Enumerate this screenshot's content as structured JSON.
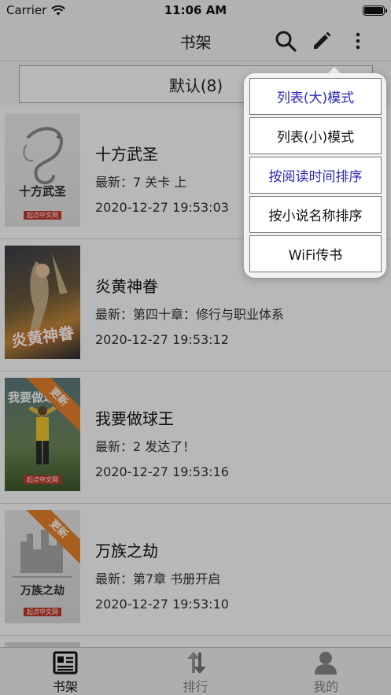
{
  "status_bar": {
    "carrier": "Carrier",
    "time": "11:06 AM"
  },
  "nav": {
    "title": "书架",
    "search_icon": "search-icon",
    "edit_icon": "pencil-icon",
    "more_icon": "more-vertical-icon"
  },
  "group_bar": {
    "label": "默认(8)"
  },
  "books": [
    {
      "title": "十方武圣",
      "latest": "最新：7 关卡 上",
      "time": "2020-12-27 19:53:03",
      "cover_text": "十方武圣",
      "cover_publisher": "起点中文网",
      "updated_badge": ""
    },
    {
      "title": "炎黄神眷",
      "latest": "最新：第四十章：修行与职业体系",
      "time": "2020-12-27 19:53:12",
      "cover_text": "炎黄神眷",
      "cover_publisher": "",
      "updated_badge": ""
    },
    {
      "title": "我要做球王",
      "latest": "最新：2 发达了！",
      "time": "2020-12-27 19:53:16",
      "cover_text": "我要做球",
      "cover_publisher": "起点中文网",
      "updated_badge": "更新"
    },
    {
      "title": "万族之劫",
      "latest": "最新：第7章 书册开启",
      "time": "2020-12-27 19:53:10",
      "cover_text": "万族之劫",
      "cover_publisher": "起点中文网",
      "updated_badge": "更新"
    }
  ],
  "popup_menu": {
    "items": [
      {
        "label": "列表(大)模式",
        "active": true
      },
      {
        "label": "列表(小)模式",
        "active": false
      },
      {
        "label": "按阅读时间排序",
        "active": true
      },
      {
        "label": "按小说名称排序",
        "active": false
      },
      {
        "label": "WiFi传书",
        "active": false
      }
    ]
  },
  "tab_bar": {
    "tabs": [
      {
        "label": "书架",
        "icon": "bookshelf-icon",
        "selected": true
      },
      {
        "label": "排行",
        "icon": "ranking-arrows-icon",
        "selected": false
      },
      {
        "label": "我的",
        "icon": "profile-icon",
        "selected": false
      }
    ]
  },
  "colors": {
    "accent": "#2a2ab8",
    "badge_orange": "#e8832a"
  }
}
